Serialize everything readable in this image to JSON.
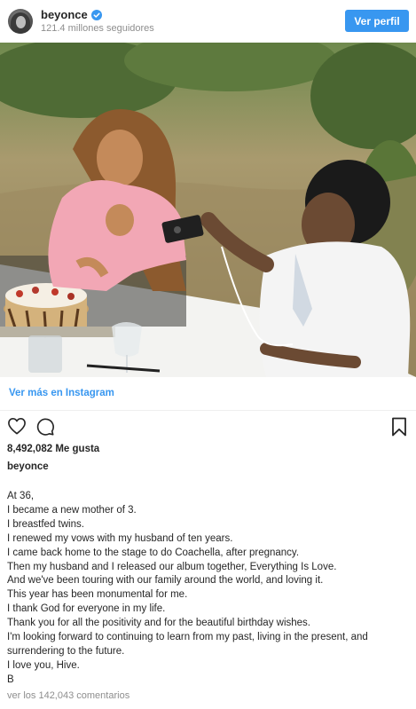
{
  "header": {
    "username": "beyonce",
    "followers": "121.4 millones seguidores",
    "view_profile_label": "Ver perfil",
    "verified_color": "#3897f0"
  },
  "post": {
    "view_more_link": "Ver más en Instagram",
    "likes": "8,492,082 Me gusta",
    "caption_username": "beyonce",
    "caption_lines": [
      "At 36,",
      "I became a new mother of 3.",
      "I breastfed twins.",
      "I renewed my vows with my husband of ten years.",
      "I came back home to the stage to do Coachella, after pregnancy.",
      "Then my husband and I released our album together, Everything Is Love.",
      "And we've been touring with our family around the world, and loving it.",
      "This year has been monumental for me.",
      "I thank God for everyone in my life.",
      "Thank you for all the positivity and for the beautiful birthday wishes.",
      "I'm looking forward to continuing to learn from my past, living in the present, and",
      "surrendering to the future.",
      "I love you, Hive.",
      "B"
    ],
    "view_comments": "ver los 142,043 comentarios"
  },
  "icons": {
    "like": "heart-icon",
    "comment": "comment-icon",
    "save": "bookmark-icon",
    "verified": "verified-icon"
  },
  "colors": {
    "accent": "#3897f0",
    "text": "#262626",
    "muted": "#8e8e8e"
  }
}
